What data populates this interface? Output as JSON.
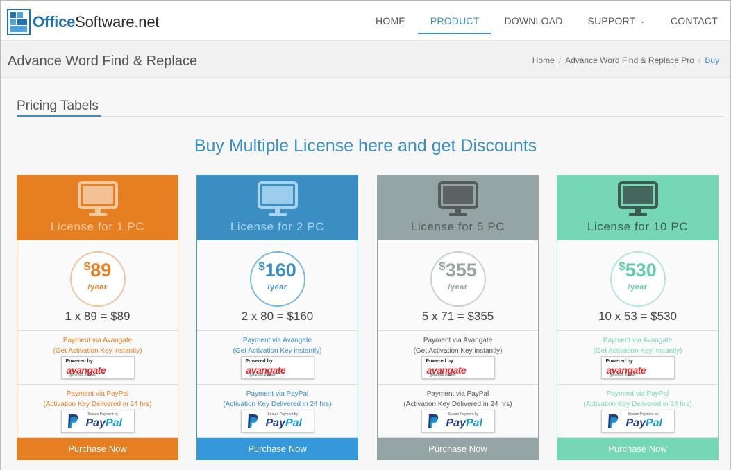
{
  "header": {
    "logo_office": "Office",
    "logo_rest": "Software.net",
    "nav": [
      {
        "label": "HOME",
        "active": false
      },
      {
        "label": "PRODUCT",
        "active": true
      },
      {
        "label": "DOWNLOAD",
        "active": false
      },
      {
        "label": "SUPPORT",
        "active": false,
        "dropdown": true
      },
      {
        "label": "CONTACT",
        "active": false
      }
    ]
  },
  "breadcrumb_bar": {
    "page_title": "Advance Word Find & Replace",
    "crumbs": [
      "Home",
      "Advance Word Find & Replace Pro",
      "Buy"
    ]
  },
  "section": {
    "title": "Pricing Tabels",
    "headline": "Buy Multiple License here and get Discounts"
  },
  "cards": [
    {
      "name": "License for 1 PC",
      "currency": "$",
      "amount": "89",
      "per": "/year",
      "calc": "1 x 89 = $89",
      "avangate_l1": "Payment via Avangate",
      "avangate_l2": "(Get Activation Key instantly)",
      "paypal_l1": "Payment via PayPal",
      "paypal_l2": "(Activation Key Delivered in 24 hrs)",
      "button": "Purchase Now",
      "head_color": "#e67e22",
      "monitor_color": "#f5c9a2",
      "accent": "#e67e22",
      "ring": "#f0c49c",
      "text_color": "#e67e22",
      "pay_text": "#e67e22"
    },
    {
      "name": "License for 2 PC",
      "currency": "$",
      "amount": "160",
      "per": "/year",
      "calc": "2 x 80 = $160",
      "avangate_l1": "Payment via Avangate",
      "avangate_l2": "(Get Activation Key instantly)",
      "paypal_l1": "Payment via PayPal",
      "paypal_l2": "(Activation Key Delivered in 24 hrs)",
      "button": "Purchase Now",
      "head_color": "#3a8ec2",
      "monitor_color": "#a8d4f2",
      "accent": "#3498db",
      "ring": "#79b7df",
      "text_color": "#3a8ec2",
      "pay_text": "#3a8ec2"
    },
    {
      "name": "License for 5 PC",
      "currency": "$",
      "amount": "355",
      "per": "/year",
      "calc": "5 x 71 = $355",
      "avangate_l1": "Payment via Avangate",
      "avangate_l2": "(Get Activation Key instantly)",
      "paypal_l1": "Payment via PayPal",
      "paypal_l2": "(Activation Key Delivered in 24 hrs)",
      "button": "Purchase Now",
      "head_color": "#95a5a6",
      "monitor_color": "#555a5c",
      "accent": "#95a5a6",
      "ring": "#c7cfcf",
      "text_color": "#95a5a6",
      "pay_text": "#555555"
    },
    {
      "name": "License for 10 PC",
      "currency": "$",
      "amount": "530",
      "per": "/year",
      "calc": "10 x 53 = $530",
      "avangate_l1": "Payment via Avangate",
      "avangate_l2": "(Get Activation Key instantly)",
      "paypal_l1": "Payment via PayPal",
      "paypal_l2": "(Activation Key Delivered in 24 hrs)",
      "button": "Purchase Now",
      "head_color": "#76d7b6",
      "monitor_color": "#3f5a52",
      "accent": "#76d7b6",
      "ring": "#b3e8d6",
      "text_color": "#5fcfaa",
      "pay_text": "#76d7b6"
    }
  ],
  "badges": {
    "avangate_small": "Powered by",
    "avangate_logo": "avangate",
    "avangate_tag": "generate e-sales",
    "paypal_small": "Secure Payment by",
    "paypal_a": "Pay",
    "paypal_b": "Pal"
  }
}
